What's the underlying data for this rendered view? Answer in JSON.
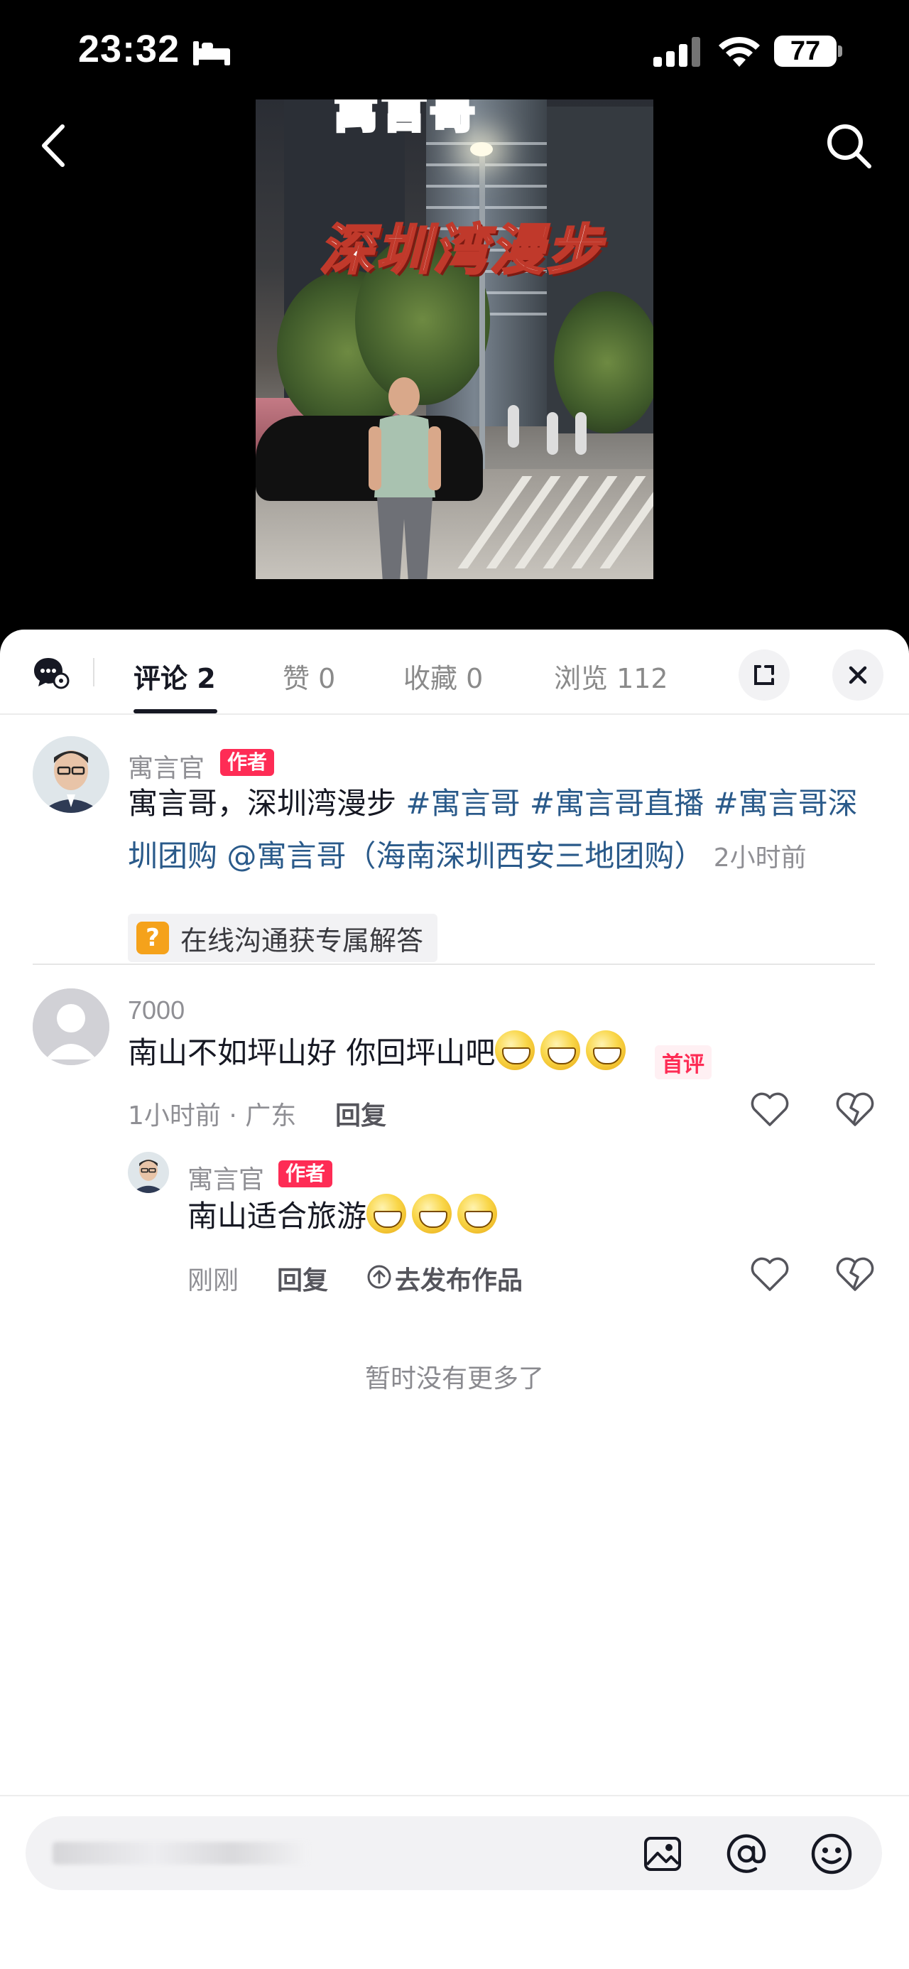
{
  "status_bar": {
    "time": "23:32",
    "battery": "77"
  },
  "video": {
    "overlay_title": "深圳湾漫步",
    "top_text": "寓言哥"
  },
  "tabs": [
    {
      "label": "评论 2"
    },
    {
      "label": "赞 0"
    },
    {
      "label": "收藏 0"
    },
    {
      "label": "浏览 112"
    }
  ],
  "post": {
    "author": "寓言官",
    "author_badge": "作者",
    "text_plain": "寓言哥，深圳湾漫步 ",
    "text_tags_1": "#寓言哥 #寓言哥直播 #寓言哥深",
    "text_tags_2": "圳团购 @寓言哥（海南深圳西安三地团购）",
    "time": "2小时前",
    "cta_label": "在线沟通获专属解答"
  },
  "comments": [
    {
      "user": "7000",
      "text": "南山不如坪山好 你回坪山吧",
      "badge": "首评",
      "meta": "1小时前 · 广东",
      "reply_label": "回复",
      "replies": [
        {
          "user": "寓言官",
          "badge": "作者",
          "text": "南山适合旅游",
          "meta": "刚刚",
          "reply_label": "回复",
          "publish_label": "去发布作品"
        }
      ]
    }
  ],
  "footer_note": "暂时没有更多了",
  "colors": {
    "accent": "#fe2c55",
    "hashtag": "#2a5a8a",
    "muted": "#8f8f94"
  }
}
